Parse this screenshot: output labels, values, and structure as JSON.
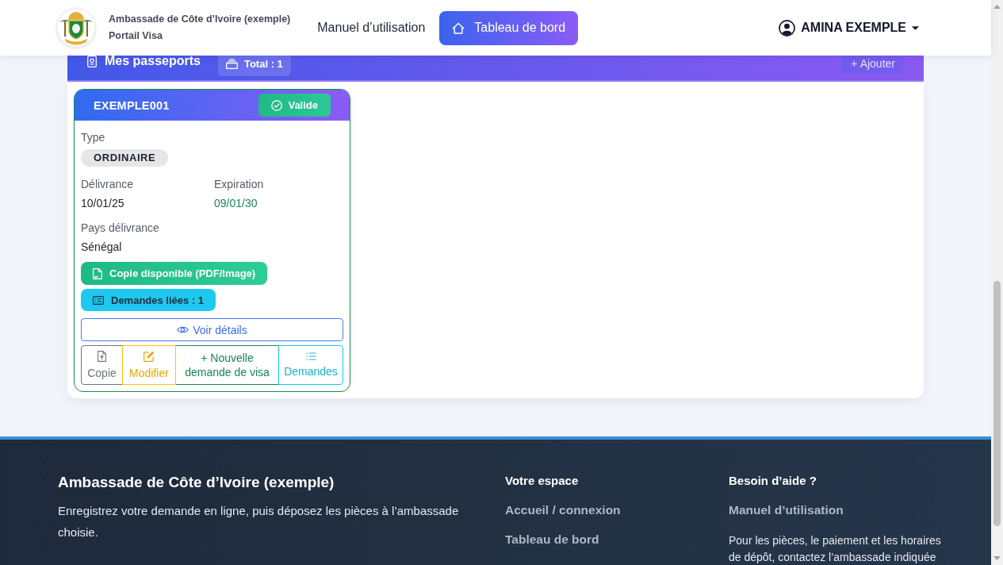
{
  "header": {
    "brand": {
      "name": "Ambassade de Côte d’Ivoire (exemple)",
      "subtitle": "Portail Visa"
    },
    "nav": [
      {
        "label": "Manuel d’utilisation",
        "kind": "text",
        "selected": false
      },
      {
        "label": "Tableau de bord",
        "kind": "icon",
        "selected": true
      }
    ],
    "user": {
      "name": "AMINA EXEMPLE"
    }
  },
  "passports": {
    "title": "Mes passeports",
    "total_badge": "Total : 1",
    "add_button": "+ Ajouter",
    "cards": [
      {
        "number": "EXEMPLE001",
        "status": {
          "label": "Valide",
          "kind": "valid"
        },
        "type_label": "Type",
        "type": "ORDINAIRE",
        "dates": [
          {
            "label": "Délivrance",
            "value": "10/01/25",
            "kind": "plain"
          },
          {
            "label": "Expiration",
            "value": "09/01/30",
            "kind": "valid"
          }
        ],
        "country": {
          "label": "Pays délivrance",
          "value": "Sénégal"
        },
        "copy_badge": "Copie disponible (PDF/Image)",
        "requests_badge": "Demandes liées : 1",
        "details_button": "Voir détails",
        "actions": [
          {
            "label": "Copie",
            "kind": "secondary"
          },
          {
            "label": "Modifier",
            "kind": "warning"
          },
          {
            "label": "+ Nouvelle demande de visa",
            "kind": "success"
          },
          {
            "label": "Demandes",
            "kind": "info"
          }
        ]
      }
    ]
  },
  "footer": {
    "title": "Ambassade de Côte d’Ivoire (exemple)",
    "description": "Enregistrez votre demande en ligne, puis déposez les pièces à l’ambassade choisie.",
    "columns": [
      {
        "heading": "Votre espace",
        "links": [
          "Accueil / connexion",
          "Tableau de bord"
        ]
      },
      {
        "heading": "Besoin d’aide ?",
        "links": [
          "Manuel d’utilisation"
        ],
        "note": "Pour les pièces, le paiement et les horaires de dépôt, contactez l’ambassade indiquée"
      }
    ]
  }
}
